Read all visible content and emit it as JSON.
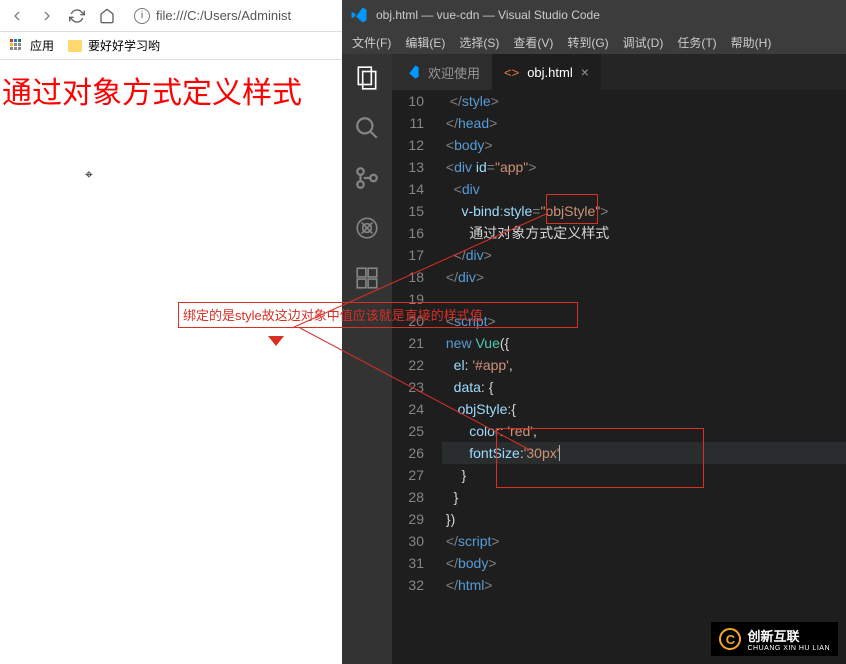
{
  "browser": {
    "url": "file:///C:/Users/Administ",
    "apps_label": "应用",
    "bookmark": "要好好学习哟"
  },
  "page": {
    "heading": "通过对象方式定义样式"
  },
  "vscode": {
    "title": "obj.html — vue-cdn — Visual Studio Code",
    "menus": [
      "文件(F)",
      "编辑(E)",
      "选择(S)",
      "查看(V)",
      "转到(G)",
      "调试(D)",
      "任务(T)",
      "帮助(H)"
    ],
    "tabs": {
      "welcome": "欢迎使用",
      "active": "obj.html"
    },
    "gutter": [
      "10",
      "11",
      "12",
      "13",
      "14",
      "15",
      "16",
      "17",
      "18",
      "19",
      "20",
      "21",
      "22",
      "23",
      "24",
      "25",
      "26",
      "27",
      "28",
      "29",
      "30",
      "31",
      "32"
    ],
    "code": {
      "l10": "</style>",
      "l11": "</head>",
      "l12": "<body>",
      "l13a": "<div ",
      "l13b": "id",
      "l13c": "=",
      "l13d": "\"app\"",
      "l13e": ">",
      "l14": "<div",
      "l15a": "v-bind",
      "l15b": ":",
      "l15c": "style",
      "l15d": "=",
      "l15e": "\"objStyle\"",
      "l15f": ">",
      "l16": "通过对象方式定义样式",
      "l17": "</div>",
      "l18": "</div>",
      "l20": "<script>",
      "l21a": "new ",
      "l21b": "Vue",
      "l21c": "({",
      "l22a": "el: ",
      "l22b": "'#app'",
      "l22c": ",",
      "l23": "data: {",
      "l24": "objStyle:{",
      "l25a": "color: ",
      "l25b": "'red'",
      "l25c": ",",
      "l26a": "fontSize:",
      "l26b": "'30px'",
      "l27": "}",
      "l28": "}",
      "l29": "})",
      "l30": "</scrip t>",
      "l31": "</body>",
      "l32": "</html>"
    }
  },
  "annotation": {
    "text": "绑定的是style故这边对象中值应该就是直接的样式值"
  },
  "watermark": {
    "brand": "创新互联",
    "sub": "CHUANG XIN HU LIAN",
    "initial": "C"
  }
}
